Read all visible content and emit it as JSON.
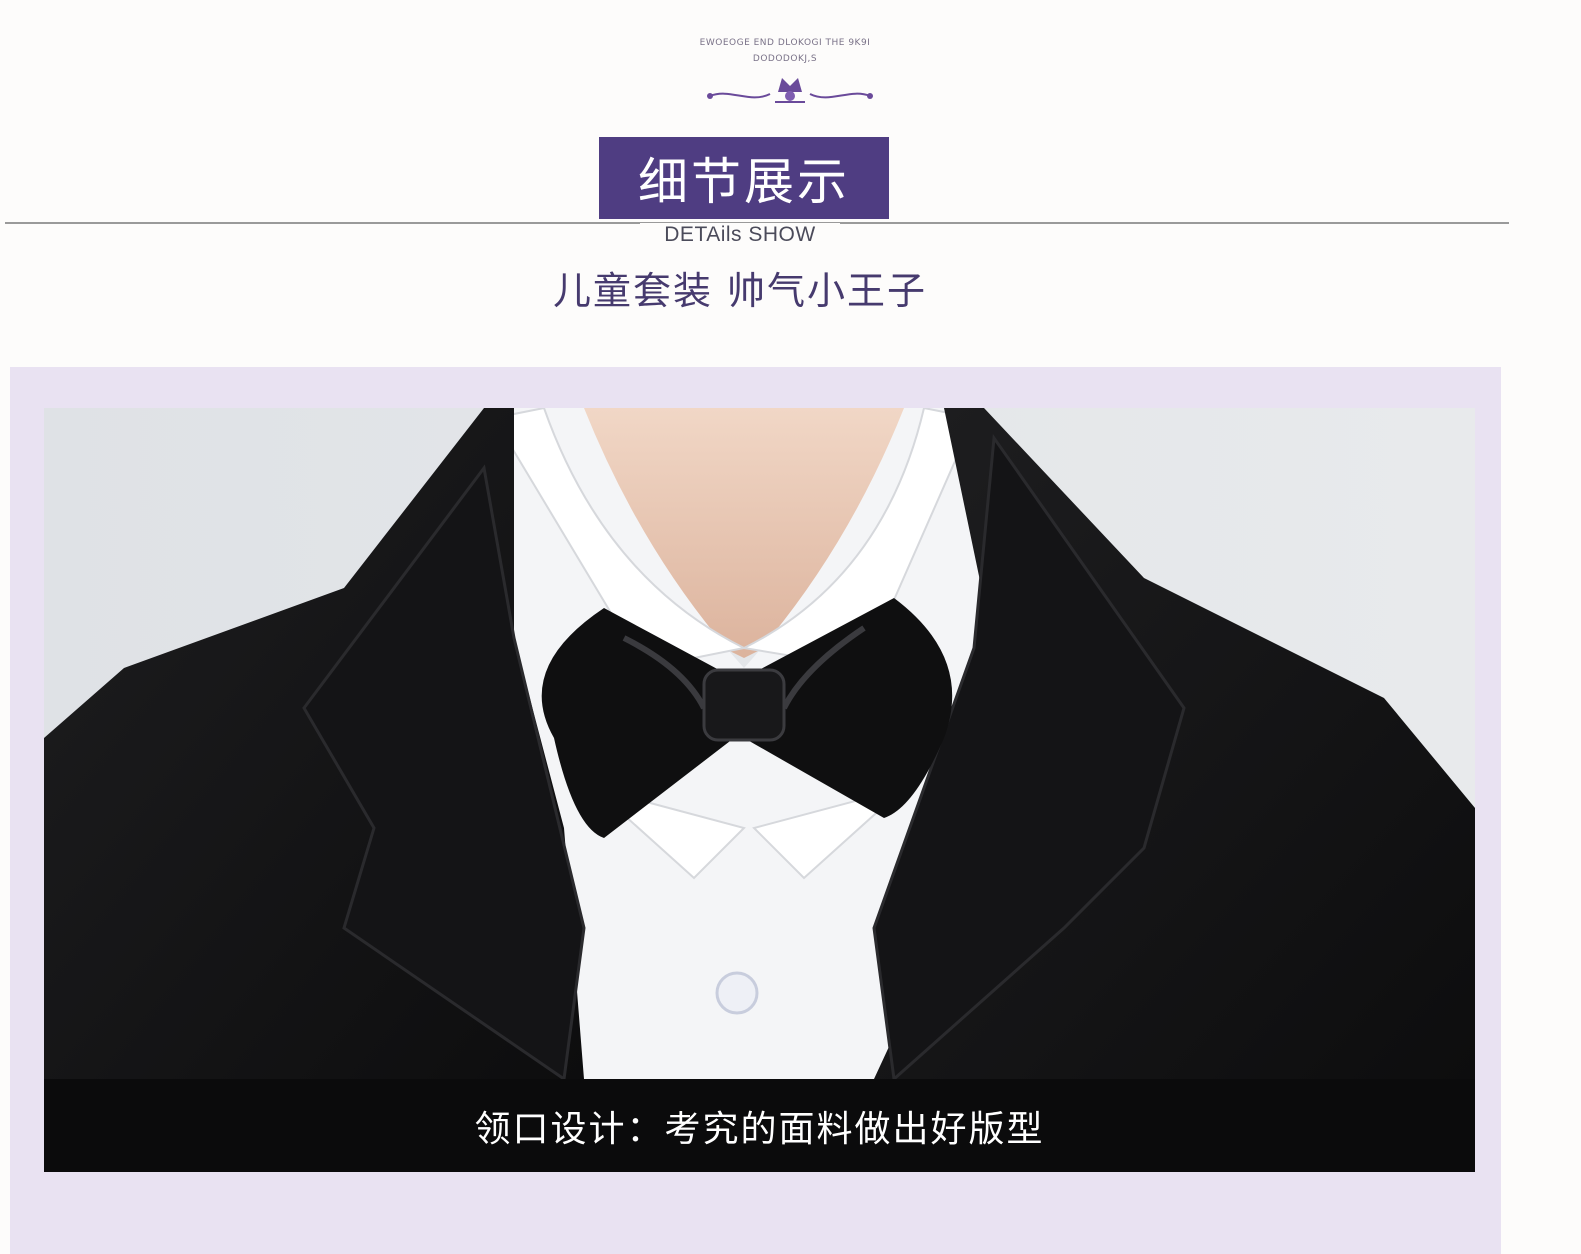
{
  "logo": {
    "line1": "EWOEOGE END DLOKOGI THE 9K9I",
    "line2": "DODODOKJ,S",
    "icon": "crown-flourish-icon"
  },
  "header": {
    "title": "细节展示",
    "english": "DETAils SHOW",
    "subtitle": "儿童套装 帅气小王子"
  },
  "photo": {
    "subject": "child-collar-bowtie-photo"
  },
  "caption": {
    "text": "领口设计：考究的面料做出好版型"
  },
  "colors": {
    "title_bg": "#4f3d82",
    "subtitle": "#463a6e",
    "panel_bg": "#e9e2f2",
    "caption_bg": "#0b0b0c"
  }
}
